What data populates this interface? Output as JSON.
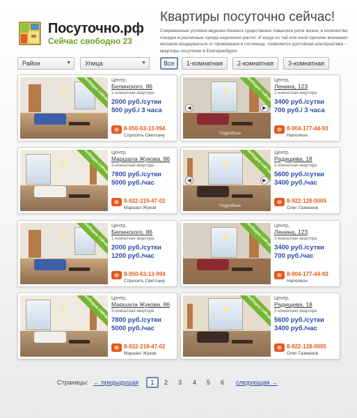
{
  "logo": {
    "title": "Посуточно.рф",
    "subtitle": "Сейчас свободно 23"
  },
  "header": {
    "title": "Квартиры посуточно сейчас!",
    "text": "Современные условия ведения бизнеса существенно повысили ритм жизни, и количество поездок в различные города неуклонно растет. И когда по той или иной причине возникает желание воздержаться от проживания в гостинице, появляется достойная альтернатива – квартиры посуточно в Екатеринбурге."
  },
  "filters": {
    "district": "Район",
    "street": "Улица",
    "all": "Все",
    "one_room": "1-комнатная",
    "two_room": "2-комнатная",
    "three_room": "3-комнатная"
  },
  "listings": [
    {
      "area": "Центр,",
      "street": "Белинского, 86",
      "rooms": "1-комнатная квартира",
      "price1": "2000 руб./сутки",
      "price2": "500 руб./ 3 часа",
      "phone": "8-950-63-13-994",
      "contact": "Спросить Светлану",
      "badge": "Свободна сейчас",
      "watermark": ""
    },
    {
      "area": "Центр,",
      "street": "Ленина, 123",
      "rooms": "2-комнатная квартира",
      "price1": "3400 руб./сутки",
      "price2": "700 руб./ 3 часа",
      "phone": "8-904-177-44-93",
      "contact": "Наполеон",
      "badge": "Свободна сейчас",
      "watermark": "Подробнее"
    },
    {
      "area": "Центр,",
      "street": "Маршала Жукова, 86",
      "rooms": "3-комнатная квартира",
      "price1": "7800 руб./сутки",
      "price2": "5000 руб./час",
      "phone": "8-922-219-47-02",
      "contact": "Маршал Жуков",
      "badge": "Свободна сейчас",
      "watermark": ""
    },
    {
      "area": "Центр,",
      "street": "Радищева, 18",
      "rooms": "3-комнатная квартира",
      "price1": "5600 руб./сутки",
      "price2": "3400 руб./час",
      "phone": "8-922-128-0005",
      "contact": "Олег Газманов",
      "badge": "Свободна сейчас",
      "watermark": "Подробнее"
    },
    {
      "area": "Центр,",
      "street": "Белинского, 86",
      "rooms": "1-комнатная квартира",
      "price1": "2000 руб./сутки",
      "price2": "1200 руб./час",
      "phone": "8-950-63-13-994",
      "contact": "Спросить Светлану",
      "badge": "Свободна сейчас",
      "watermark": ""
    },
    {
      "area": "Центр,",
      "street": "Ленина, 123",
      "rooms": "2-комнатная квартира",
      "price1": "3400 руб./сутки",
      "price2": "700 руб./час",
      "phone": "8-904-177-44-93",
      "contact": "Наполеон",
      "badge": "Свободна сейчас",
      "watermark": ""
    },
    {
      "area": "Центр,",
      "street": "Маршала Жукова, 86",
      "rooms": "3-комнатная квартира",
      "price1": "7800 руб./сутки",
      "price2": "5000 руб./час",
      "phone": "8-922-219-47-02",
      "contact": "Маршал Жуков",
      "badge": "Свободна сейчас",
      "watermark": ""
    },
    {
      "area": "Центр,",
      "street": "Радищева, 18",
      "rooms": "3-комнатная квартира",
      "price1": "5600 руб./сутки",
      "price2": "3400 руб./час",
      "phone": "8-922-128-0005",
      "contact": "Олег Газманов",
      "badge": "Свободна сейчас",
      "watermark": ""
    }
  ],
  "pager": {
    "label": "Страницы:",
    "prev": "← предыдущая",
    "pages": [
      "1",
      "2",
      "3",
      "4",
      "5",
      "6"
    ],
    "current": "1",
    "next": "следующая →"
  },
  "colors": {
    "accent_green": "#6aa41f",
    "price_blue": "#2a4aa8",
    "phone_orange": "#e65a16",
    "badge_green": "#74b532"
  }
}
